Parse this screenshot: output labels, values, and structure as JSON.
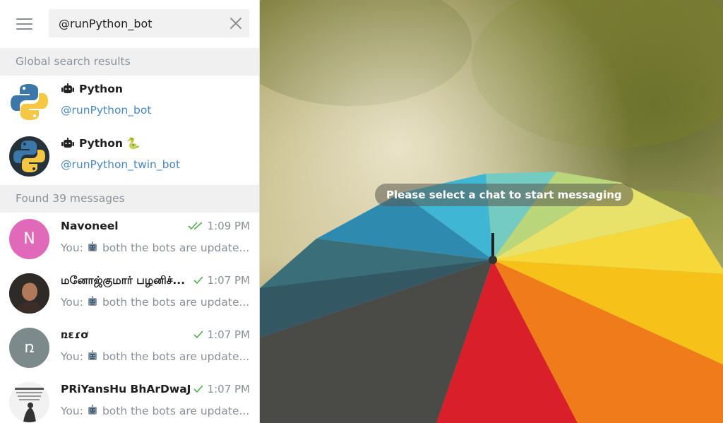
{
  "search": {
    "value": "@runPython_bot",
    "menu_icon": "hamburger-menu-icon",
    "clear_icon": "close-icon"
  },
  "global_section": {
    "title": "Global search results"
  },
  "global_results": [
    {
      "name": "Python",
      "handle": "@runPython_bot",
      "icon": "bot-icon",
      "emoji": ""
    },
    {
      "name": "Python",
      "handle": "@runPython_twin_bot",
      "icon": "bot-icon",
      "emoji": "🐍"
    }
  ],
  "messages_section": {
    "title": "Found 39 messages"
  },
  "messages": [
    {
      "name": "Navoneel",
      "time": "1:09 PM",
      "status": "read",
      "prefix": "You:",
      "text": "both the bots are update...",
      "avatar_letter": "N",
      "avatar_color": "#e06ab9"
    },
    {
      "name": "மனோஜ்குமார் பழனிச்...",
      "time": "1:07 PM",
      "status": "sent",
      "prefix": "You:",
      "text": "both the bots are update...",
      "avatar_letter": "",
      "avatar_color": "#2b2b2b"
    },
    {
      "name": "ռɛɾơ",
      "time": "1:07 PM",
      "status": "sent",
      "prefix": "You:",
      "text": "both the bots are update...",
      "avatar_letter": "ռ",
      "avatar_color": "#7c8a8c"
    },
    {
      "name": "PRiYansHu BhArDwaJ",
      "time": "1:07 PM",
      "status": "sent",
      "prefix": "You:",
      "text": "both the bots are update...",
      "avatar_letter": "",
      "avatar_color": "#e8e8e8"
    }
  ],
  "chat": {
    "placeholder": "Please select a chat to start messaging"
  },
  "colors": {
    "accent": "#4a88c4",
    "check": "#4fae4e",
    "section_bg": "#f0f0f0"
  }
}
